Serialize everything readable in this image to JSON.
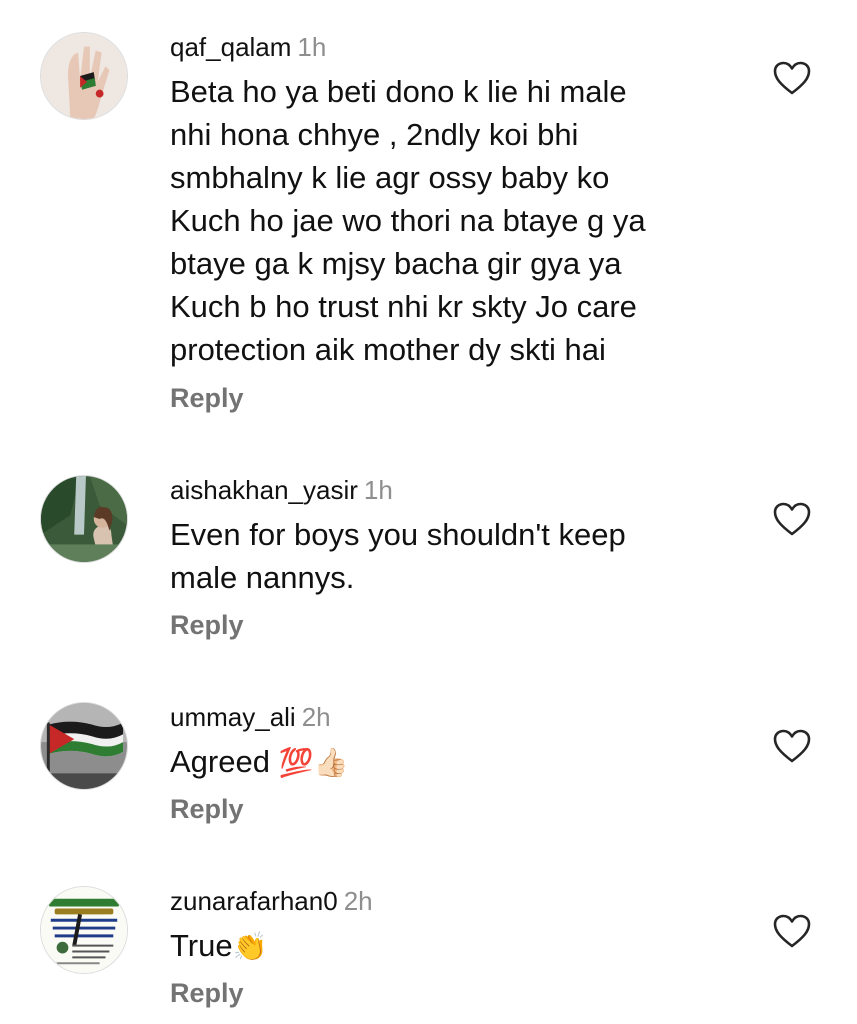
{
  "comments": [
    {
      "username": "qaf_qalam",
      "time": "1h",
      "lines": [
        "Beta ho ya beti dono k lie hi male",
        "nhi hona chhye , 2ndly koi bhi",
        "smbhalny k lie agr ossy baby ko",
        "Kuch ho jae wo thori na btaye g ya",
        "btaye ga  k mjsy bacha gir gya ya",
        "Kuch b ho trust nhi kr skty Jo care",
        "protection aik mother dy skti hai"
      ],
      "reply_label": "Reply",
      "avatar_icon": "hand-painted-flag-avatar"
    },
    {
      "username": "aishakhan_yasir",
      "time": "1h",
      "lines": [
        "Even for boys you shouldn't keep",
        "male nannys."
      ],
      "reply_label": "Reply",
      "avatar_icon": "woman-waterfall-avatar"
    },
    {
      "username": "ummay_ali",
      "time": "2h",
      "text": "Agreed",
      "emoji": "💯👍🏻",
      "reply_label": "Reply",
      "avatar_icon": "palestine-flag-avatar"
    },
    {
      "username": "zunarafarhan0",
      "time": "2h",
      "text": "True",
      "emoji": "👏",
      "reply_label": "Reply",
      "avatar_icon": "urdu-poster-avatar"
    }
  ],
  "icons": {
    "like": "heart-outline-icon"
  },
  "colors": {
    "text": "#111111",
    "muted": "#8e8e8e",
    "reply": "#737373"
  }
}
